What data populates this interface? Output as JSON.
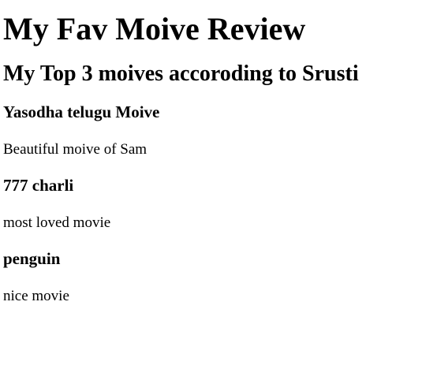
{
  "page": {
    "heading": "My Fav Moive Review",
    "subheading": "My Top 3 moives accoroding to Srusti",
    "movies": [
      {
        "title": "Yasodha telugu Moive",
        "review": "Beautiful moive of Sam"
      },
      {
        "title": "777 charli",
        "review": "most loved movie"
      },
      {
        "title": "penguin",
        "review": "nice movie"
      }
    ]
  }
}
